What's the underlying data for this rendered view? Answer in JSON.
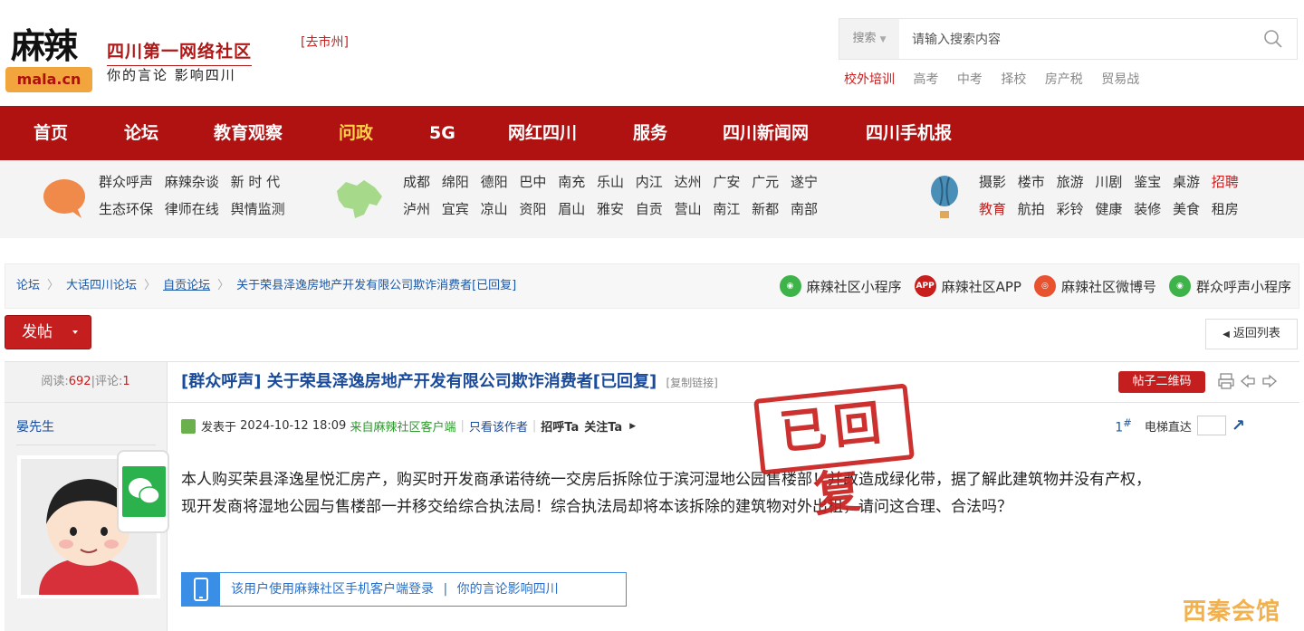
{
  "header": {
    "logo_cn": "麻辣",
    "logo_en": "mala.cn",
    "site_title": "四川第一网络社区",
    "site_slogan": "你的言论 影响四川",
    "city_link": "[去市州]",
    "search": {
      "type_label": "搜索",
      "placeholder": "请输入搜索内容"
    },
    "hot_links": [
      "校外培训",
      "高考",
      "中考",
      "择校",
      "房产税",
      "贸易战"
    ]
  },
  "nav": {
    "items": [
      "首页",
      "论坛",
      "教育观察",
      "问政",
      "5G",
      "网红四川",
      "服务",
      "四川新闻网",
      "四川手机报"
    ],
    "active_index": 3
  },
  "quick": {
    "group1_row1": [
      "群众呼声",
      "麻辣杂谈",
      "新 时 代"
    ],
    "group1_row2": [
      "生态环保",
      "律师在线",
      "舆情监测"
    ],
    "cities_row1": [
      "成都",
      "绵阳",
      "德阳",
      "巴中",
      "南充",
      "乐山",
      "内江",
      "达州",
      "广安",
      "广元",
      "遂宁"
    ],
    "cities_row2": [
      "泸州",
      "宜宾",
      "凉山",
      "资阳",
      "眉山",
      "雅安",
      "自贡",
      "营山",
      "南江",
      "新都",
      "南部"
    ],
    "topics_row1": [
      "摄影",
      "楼市",
      "旅游",
      "川剧",
      "鉴宝",
      "桌游",
      "招聘"
    ],
    "topics_row2": [
      "教育",
      "航拍",
      "彩铃",
      "健康",
      "装修",
      "美食",
      "租房"
    ]
  },
  "breadcrumb": {
    "items": [
      "论坛",
      "大话四川论坛",
      "自贡论坛",
      "关于荣县泽逸房地产开发有限公司欺诈消费者[已回复]"
    ],
    "links": [
      {
        "label": "麻辣社区小程序",
        "icon": "wechat-mini-icon",
        "color": "#3db34a"
      },
      {
        "label": "麻辣社区APP",
        "icon": "app-icon",
        "color": "#c81e1e"
      },
      {
        "label": "麻辣社区微博号",
        "icon": "weibo-icon",
        "color": "#e8522f"
      },
      {
        "label": "群众呼声小程序",
        "icon": "wechat-mini-icon",
        "color": "#3db34a"
      }
    ],
    "app_badge": "APP"
  },
  "toolbar": {
    "post_label": "发帖",
    "back_label": "返回列表"
  },
  "post": {
    "reads_label": "阅读:",
    "reads": "692",
    "replies_label": "评论:",
    "replies": "1",
    "title": "[群众呼声] 关于荣县泽逸房地产开发有限公司欺诈消费者[已回复]",
    "copy_link": "[复制链接]",
    "qr_label": "帖子二维码",
    "author": "晏先生",
    "posted_prefix": "发表于",
    "posted_time": "2024-10-12 18:09",
    "from_client": "来自麻辣社区客户端",
    "only_author": "只看该作者",
    "greet": "招呼Ta",
    "follow": "关注Ta",
    "floor": "1",
    "floor_symbol": "#",
    "elevator_label": "电梯直达",
    "body_line1": "本人购买荣县泽逸星悦汇房产，购买时开发商承诺待统一交房后拆除位于滨河湿地公园售楼部！并改造成绿化带，据了解此建筑物并没有产权，",
    "body_line2": "现开发商将湿地公园与售楼部一并移交给综合执法局！综合执法局却将本该拆除的建筑物对外出租，请问这合理、合法吗？",
    "client_note": "该用户使用麻辣社区手机客户端登录",
    "client_slogan": "你的言论影响四川",
    "stamp": "已回复"
  },
  "watermark": "西秦会馆",
  "colors": {
    "brand_red": "#b01212",
    "link_blue": "#1a4a9a",
    "accent_yellow": "#ffd24a"
  }
}
